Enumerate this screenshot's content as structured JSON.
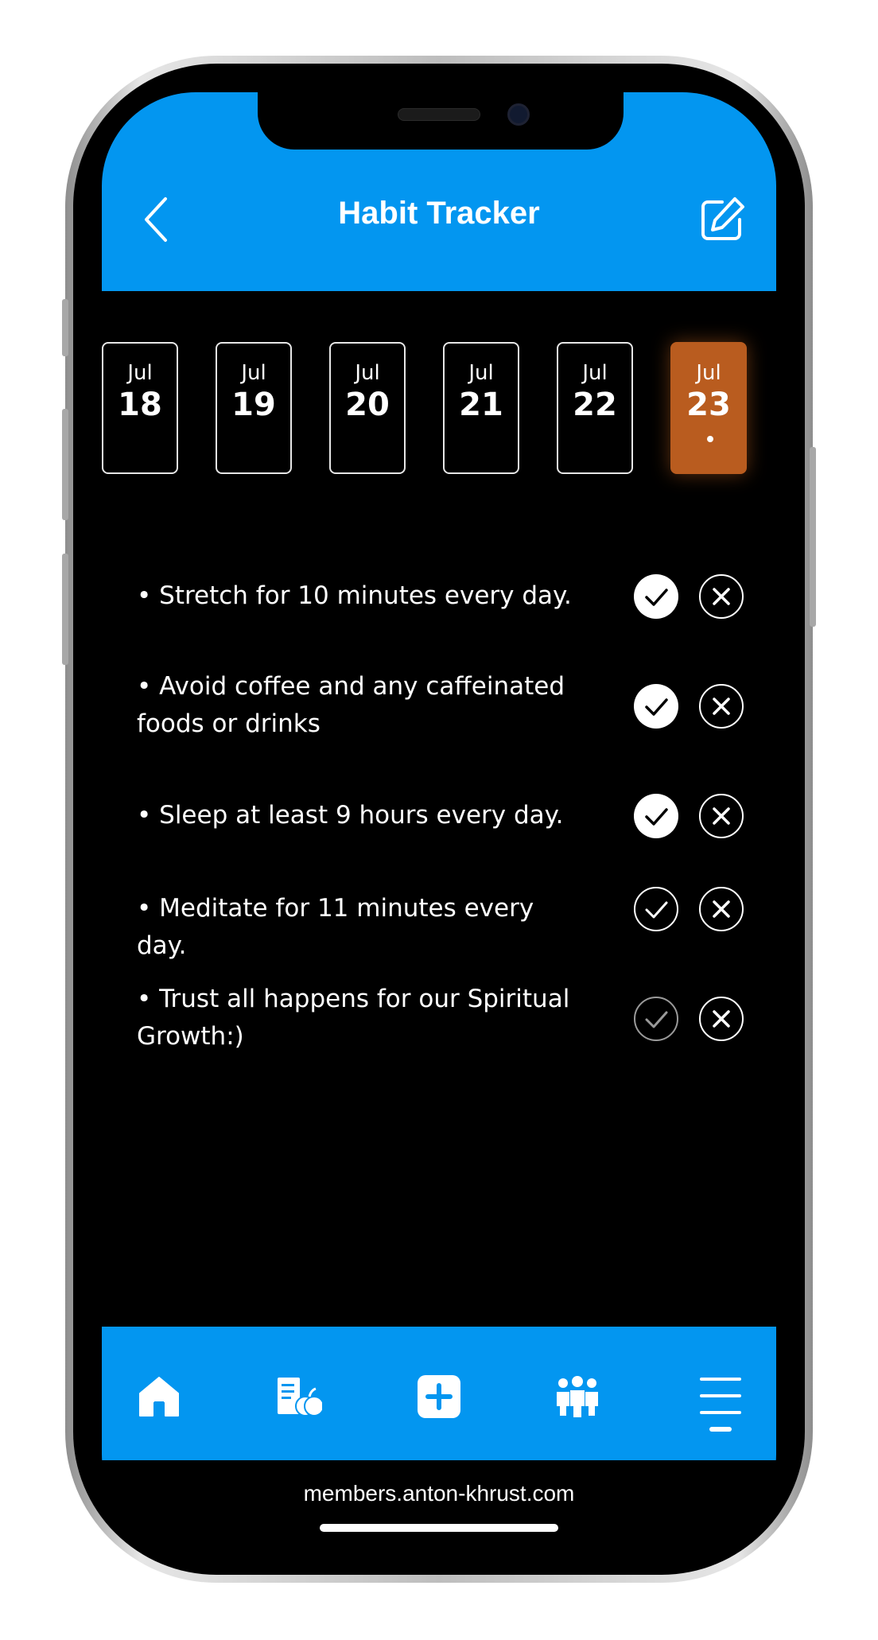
{
  "header": {
    "title": "Habit Tracker",
    "back_icon": "chevron-left-icon",
    "edit_icon": "edit-icon",
    "background": "#0396f0"
  },
  "dates": [
    {
      "month": "Jul",
      "day": "18",
      "selected": false
    },
    {
      "month": "Jul",
      "day": "19",
      "selected": false
    },
    {
      "month": "Jul",
      "day": "20",
      "selected": false
    },
    {
      "month": "Jul",
      "day": "21",
      "selected": false
    },
    {
      "month": "Jul",
      "day": "22",
      "selected": false
    },
    {
      "month": "Jul",
      "day": "23",
      "selected": true
    }
  ],
  "selected_color": "#b95c1f",
  "habits": [
    {
      "text": "• Stretch for 10 minutes every day.",
      "check_state": "done"
    },
    {
      "text": "• Avoid coffee and any caffeinated foods or drinks",
      "check_state": "done"
    },
    {
      "text": "• Sleep at least 9 hours every day.",
      "check_state": "done"
    },
    {
      "text": "• Meditate for 11 minutes every day.",
      "check_state": "unchecked"
    },
    {
      "text": "• Trust all happens for our Spiritual Growth:)",
      "check_state": "unchecked-dim"
    }
  ],
  "tabbar": {
    "items": [
      "home-icon",
      "nutrition-icon",
      "add-icon",
      "group-icon",
      "menu-icon"
    ],
    "active": "menu-icon"
  },
  "footer": {
    "url": "members.anton-khrust.com"
  }
}
